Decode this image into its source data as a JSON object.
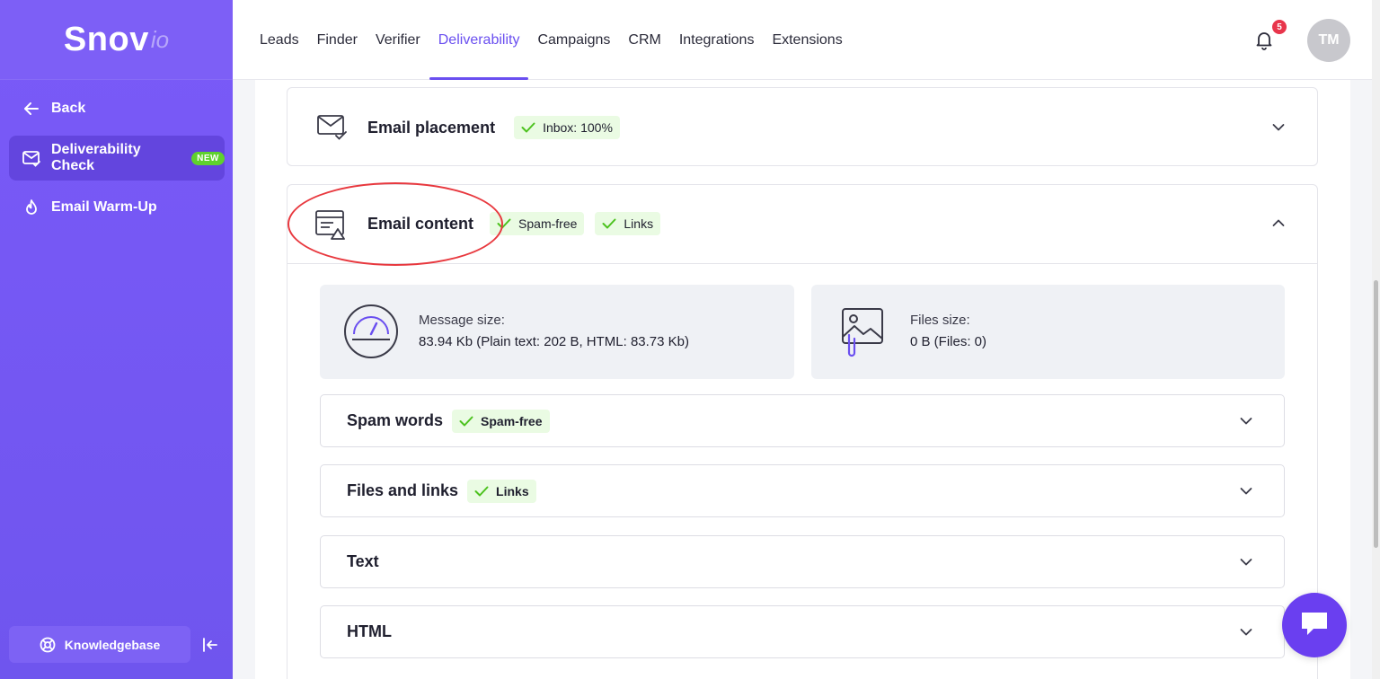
{
  "brand": {
    "name": "Snov",
    "suffix": "io"
  },
  "sidebar": {
    "back_label": "Back",
    "items": [
      {
        "label": "Deliverability Check",
        "badge": "NEW",
        "active": true,
        "icon": "mail-check-icon"
      },
      {
        "label": "Email Warm-Up",
        "icon": "flame-icon"
      }
    ],
    "knowledgebase_label": "Knowledgebase"
  },
  "nav": {
    "items": [
      "Leads",
      "Finder",
      "Verifier",
      "Deliverability",
      "Campaigns",
      "CRM",
      "Integrations",
      "Extensions"
    ],
    "active": "Deliverability",
    "notification_count": "5",
    "avatar_initials": "TM"
  },
  "sections": {
    "placement": {
      "title": "Email placement",
      "badges": [
        "Inbox: 100%"
      ],
      "expanded": false
    },
    "content": {
      "title": "Email content",
      "badges": [
        "Spam-free",
        "Links"
      ],
      "expanded": true,
      "message_size_label": "Message size:",
      "message_size_value": "83.94 Kb (Plain text: 202 B, HTML: 83.73 Kb)",
      "files_size_label": "Files size:",
      "files_size_value": "0 B (Files: 0)",
      "subsections": [
        {
          "title": "Spam words",
          "badge": "Spam-free"
        },
        {
          "title": "Files and links",
          "badge": "Links"
        },
        {
          "title": "Text",
          "badge": ""
        },
        {
          "title": "HTML",
          "badge": ""
        }
      ]
    }
  },
  "colors": {
    "accent": "#6a4ff0",
    "sidebar": "#7a5af8",
    "success_bg": "#eafbe3",
    "success": "#5fd12d",
    "highlight": "#e8383e"
  }
}
